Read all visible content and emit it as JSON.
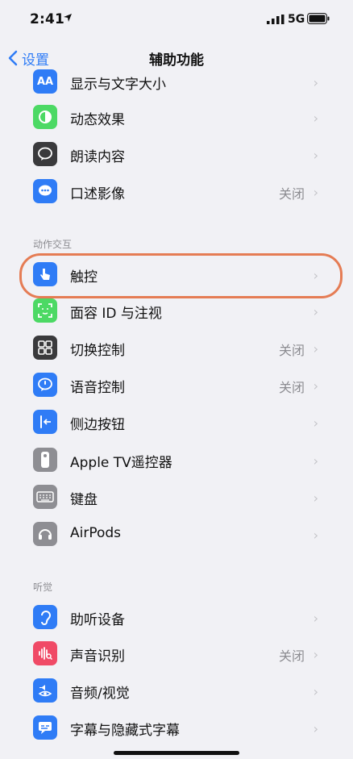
{
  "status": {
    "time": "2:41",
    "network": "5G"
  },
  "nav": {
    "back_label": "设置",
    "title": "辅助功能"
  },
  "sections": [
    {
      "header": "",
      "items": [
        {
          "label": "显示与文字大小",
          "value": "",
          "icon": "text-size-icon",
          "color": "#2f7cf6"
        },
        {
          "label": "动态效果",
          "value": "",
          "icon": "motion-icon",
          "color": "#4cd964"
        },
        {
          "label": "朗读内容",
          "value": "",
          "icon": "speech-icon",
          "color": "#3a3a3c"
        },
        {
          "label": "口述影像",
          "value": "关闭",
          "icon": "audio-description-icon",
          "color": "#2f7cf6"
        }
      ]
    },
    {
      "header": "动作交互",
      "items": [
        {
          "label": "触控",
          "value": "",
          "icon": "touch-icon",
          "color": "#2f7cf6"
        },
        {
          "label": "面容 ID 与注视",
          "value": "",
          "icon": "face-id-icon",
          "color": "#4cd964"
        },
        {
          "label": "切换控制",
          "value": "关闭",
          "icon": "switch-control-icon",
          "color": "#3a3a3c"
        },
        {
          "label": "语音控制",
          "value": "关闭",
          "icon": "voice-control-icon",
          "color": "#2f7cf6"
        },
        {
          "label": "侧边按钮",
          "value": "",
          "icon": "side-button-icon",
          "color": "#2f7cf6"
        },
        {
          "label": "Apple TV遥控器",
          "value": "",
          "icon": "tv-remote-icon",
          "color": "#8e8e93"
        },
        {
          "label": "键盘",
          "value": "",
          "icon": "keyboard-icon",
          "color": "#8e8e93"
        },
        {
          "label": "AirPods",
          "value": "",
          "icon": "airpods-icon",
          "color": "#8e8e93"
        }
      ]
    },
    {
      "header": "听觉",
      "items": [
        {
          "label": "助听设备",
          "value": "",
          "icon": "hearing-device-icon",
          "color": "#2f7cf6"
        },
        {
          "label": "声音识别",
          "value": "关闭",
          "icon": "sound-recognition-icon",
          "color": "#f04a66"
        },
        {
          "label": "音频/视觉",
          "value": "",
          "icon": "audio-visual-icon",
          "color": "#2f7cf6"
        },
        {
          "label": "字幕与隐藏式字幕",
          "value": "",
          "icon": "subtitles-icon",
          "color": "#2f7cf6"
        }
      ]
    }
  ]
}
